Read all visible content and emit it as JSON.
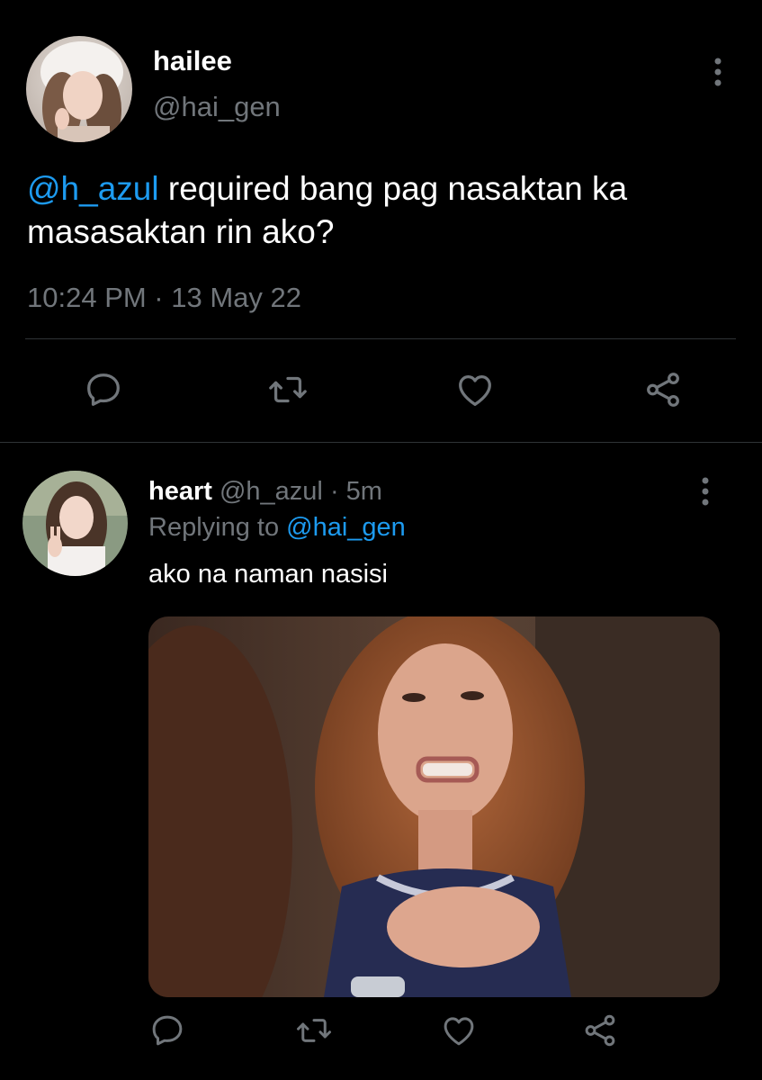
{
  "main_tweet": {
    "display_name": "hailee",
    "handle": "@hai_gen",
    "text_mention": "@h_azul",
    "text_body": " required bang pag nasaktan ka masasaktan rin ako?",
    "timestamp": "10:24 PM · 13 May 22",
    "actions": [
      "reply-icon",
      "retweet-icon",
      "like-icon",
      "share-icon"
    ]
  },
  "reply_tweet": {
    "display_name": "heart",
    "handle": "@h_azul",
    "separator": " · ",
    "time": "5m",
    "replying_prefix": "Replying to ",
    "replying_to": "@hai_gen",
    "text": "ako na naman nasisi",
    "actions": [
      "reply-icon",
      "retweet-icon",
      "like-icon",
      "share-icon"
    ]
  },
  "colors": {
    "background": "#000000",
    "text_primary": "#ffffff",
    "text_secondary": "#71767b",
    "accent": "#1d9bf0",
    "border": "#2f3336"
  }
}
